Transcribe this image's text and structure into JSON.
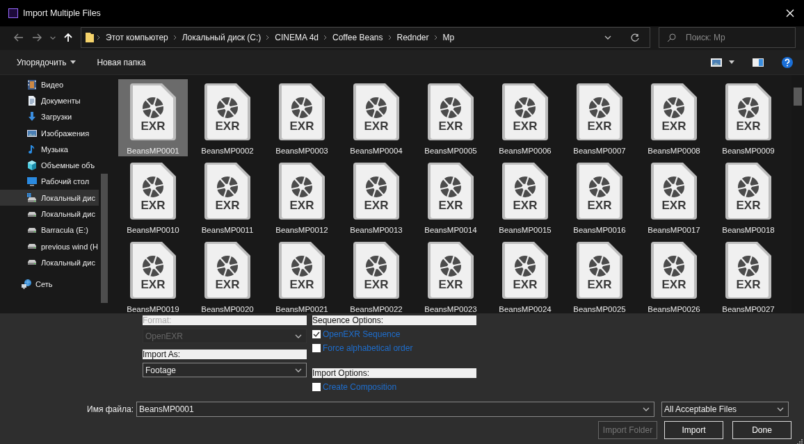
{
  "window": {
    "title": "Import Multiple Files"
  },
  "address": {
    "crumbs": [
      "Этот компьютер",
      "Локальный диск (C:)",
      "CINEMA 4d",
      "Coffee Beans",
      "Rednder",
      "Mp"
    ]
  },
  "search": {
    "placeholder": "Поиск: Mp"
  },
  "toolbar": [
    {
      "label": "Упорядочить",
      "kind": "menu"
    },
    {
      "label": "Новая папка",
      "kind": "button"
    }
  ],
  "sidebar": {
    "items": [
      {
        "label": "Видео",
        "kind": "video",
        "selected": false
      },
      {
        "label": "Документы",
        "kind": "documents",
        "selected": false
      },
      {
        "label": "Загрузки",
        "kind": "downloads",
        "selected": false
      },
      {
        "label": "Изображения",
        "kind": "pictures",
        "selected": false
      },
      {
        "label": "Музыка",
        "kind": "music",
        "selected": false
      },
      {
        "label": "Объемные объ",
        "kind": "objects",
        "selected": false
      },
      {
        "label": "Рабочий стол",
        "kind": "desktop",
        "selected": false
      },
      {
        "label": "Локальный дис",
        "kind": "system-drive",
        "selected": true
      },
      {
        "label": "Локальный дис",
        "kind": "drive",
        "selected": false
      },
      {
        "label": "Barracula (E:)",
        "kind": "drive",
        "selected": false
      },
      {
        "label": "previous wind (H",
        "kind": "drive",
        "selected": false
      },
      {
        "label": "Локальный дис",
        "kind": "drive",
        "selected": false
      },
      {
        "label": "Сеть",
        "kind": "network",
        "selected": false
      }
    ]
  },
  "files": [
    {
      "name": "BeansMP0001",
      "badge": "EXR",
      "selected": true
    },
    {
      "name": "BeansMP0002",
      "badge": "EXR",
      "selected": false
    },
    {
      "name": "BeansMP0003",
      "badge": "EXR",
      "selected": false
    },
    {
      "name": "BeansMP0004",
      "badge": "EXR",
      "selected": false
    },
    {
      "name": "BeansMP0005",
      "badge": "EXR",
      "selected": false
    },
    {
      "name": "BeansMP0006",
      "badge": "EXR",
      "selected": false
    },
    {
      "name": "BeansMP0007",
      "badge": "EXR",
      "selected": false
    },
    {
      "name": "BeansMP0008",
      "badge": "EXR",
      "selected": false
    },
    {
      "name": "BeansMP0009",
      "badge": "EXR",
      "selected": false
    },
    {
      "name": "BeansMP0010",
      "badge": "EXR",
      "selected": false
    },
    {
      "name": "BeansMP0011",
      "badge": "EXR",
      "selected": false
    },
    {
      "name": "BeansMP0012",
      "badge": "EXR",
      "selected": false
    },
    {
      "name": "BeansMP0013",
      "badge": "EXR",
      "selected": false
    },
    {
      "name": "BeansMP0014",
      "badge": "EXR",
      "selected": false
    },
    {
      "name": "BeansMP0015",
      "badge": "EXR",
      "selected": false
    },
    {
      "name": "BeansMP0016",
      "badge": "EXR",
      "selected": false
    },
    {
      "name": "BeansMP0017",
      "badge": "EXR",
      "selected": false
    },
    {
      "name": "BeansMP0018",
      "badge": "EXR",
      "selected": false
    },
    {
      "name": "BeansMP0019",
      "badge": "EXR",
      "selected": false
    },
    {
      "name": "BeansMP0020",
      "badge": "EXR",
      "selected": false
    },
    {
      "name": "BeansMP0021",
      "badge": "EXR",
      "selected": false
    },
    {
      "name": "BeansMP0022",
      "badge": "EXR",
      "selected": false
    },
    {
      "name": "BeansMP0023",
      "badge": "EXR",
      "selected": false
    },
    {
      "name": "BeansMP0024",
      "badge": "EXR",
      "selected": false
    },
    {
      "name": "BeansMP0025",
      "badge": "EXR",
      "selected": false
    },
    {
      "name": "BeansMP0026",
      "badge": "EXR",
      "selected": false
    },
    {
      "name": "BeansMP0027",
      "badge": "EXR",
      "selected": false
    }
  ],
  "format": {
    "label": "Format:",
    "value": "OpenEXR",
    "disabled": true
  },
  "import_as": {
    "label": "Import As:",
    "value": "Footage",
    "disabled": false
  },
  "sequence_options": {
    "label": "Sequence Options:",
    "checks": [
      {
        "label": "OpenEXR Sequence",
        "checked": true
      },
      {
        "label": "Force alphabetical order",
        "checked": false
      }
    ]
  },
  "import_options": {
    "label": "Import Options:",
    "checks": [
      {
        "label": "Create Composition",
        "checked": false
      }
    ]
  },
  "filename": {
    "label": "Имя файла:",
    "value": "BeansMP0001"
  },
  "filter": {
    "value": "All Acceptable Files"
  },
  "buttons": [
    {
      "label": "Import Folder",
      "disabled": true
    },
    {
      "label": "Import",
      "disabled": false
    },
    {
      "label": "Done",
      "disabled": false
    }
  ]
}
